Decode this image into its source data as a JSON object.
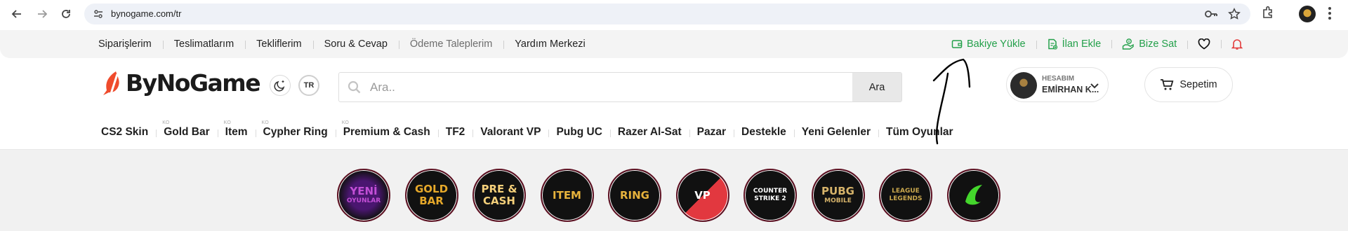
{
  "browser": {
    "url": "bynogame.com/tr"
  },
  "topbar": {
    "links": [
      {
        "label": "Siparişlerim"
      },
      {
        "label": "Teslimatlarım"
      },
      {
        "label": "Tekliflerim"
      },
      {
        "label": "Soru & Cevap"
      },
      {
        "label": "Ödeme Taleplerim"
      },
      {
        "label": "Yardım Merkezi"
      }
    ],
    "actions": [
      {
        "label": "Bakiye Yükle",
        "icon": "wallet-icon"
      },
      {
        "label": "İlan Ekle",
        "icon": "add-listing-icon"
      },
      {
        "label": "Bize Sat",
        "icon": "hand-money-icon"
      }
    ],
    "accent_color": "#23a04a",
    "notification_color": "#e23b3b"
  },
  "header": {
    "logo_text": "ByNoGame",
    "lang": "TR",
    "search": {
      "placeholder": "Ara..",
      "button_label": "Ara"
    },
    "account": {
      "label": "HESABIM",
      "name": "EMİRHAN K..."
    },
    "cart_label": "Sepetim"
  },
  "categories": [
    {
      "label": "CS2 Skin",
      "sup": ""
    },
    {
      "label": "Gold Bar",
      "sup": "KO"
    },
    {
      "label": "Item",
      "sup": "KO"
    },
    {
      "label": "Cypher Ring",
      "sup": "KO"
    },
    {
      "label": "Premium & Cash",
      "sup": "KO"
    },
    {
      "label": "TF2",
      "sup": ""
    },
    {
      "label": "Valorant VP",
      "sup": ""
    },
    {
      "label": "Pubg UC",
      "sup": ""
    },
    {
      "label": "Razer Al-Sat",
      "sup": ""
    },
    {
      "label": "Pazar",
      "sup": ""
    },
    {
      "label": "Destekle",
      "sup": ""
    },
    {
      "label": "Yeni Gelenler",
      "sup": ""
    },
    {
      "label": "Tüm Oyunlar",
      "sup": ""
    }
  ],
  "game_circles": [
    {
      "line1": "YENİ",
      "line2": "OYUNLAR",
      "color": "#c24fd6"
    },
    {
      "line1": "GOLD",
      "line2": "BAR",
      "color": "#e6a82a"
    },
    {
      "line1": "PRE &",
      "line2": "CASH",
      "color": "#f5d07a"
    },
    {
      "line1": "ITEM",
      "line2": "",
      "color": "#e6b23c"
    },
    {
      "line1": "RING",
      "line2": "",
      "color": "#e6b23c"
    },
    {
      "line1": "VP",
      "line2": "",
      "color": "#ffffff"
    },
    {
      "line1": "COUNTER",
      "line2": "STRIKE 2",
      "color": "#ffffff"
    },
    {
      "line1": "PUBG",
      "line2": "MOBILE",
      "color": "#d6b36a"
    },
    {
      "line1": "LEAGUE",
      "line2": "LEGENDS",
      "color": "#c9a74d"
    },
    {
      "line1": "",
      "line2": "",
      "color": "#44d62c"
    }
  ]
}
